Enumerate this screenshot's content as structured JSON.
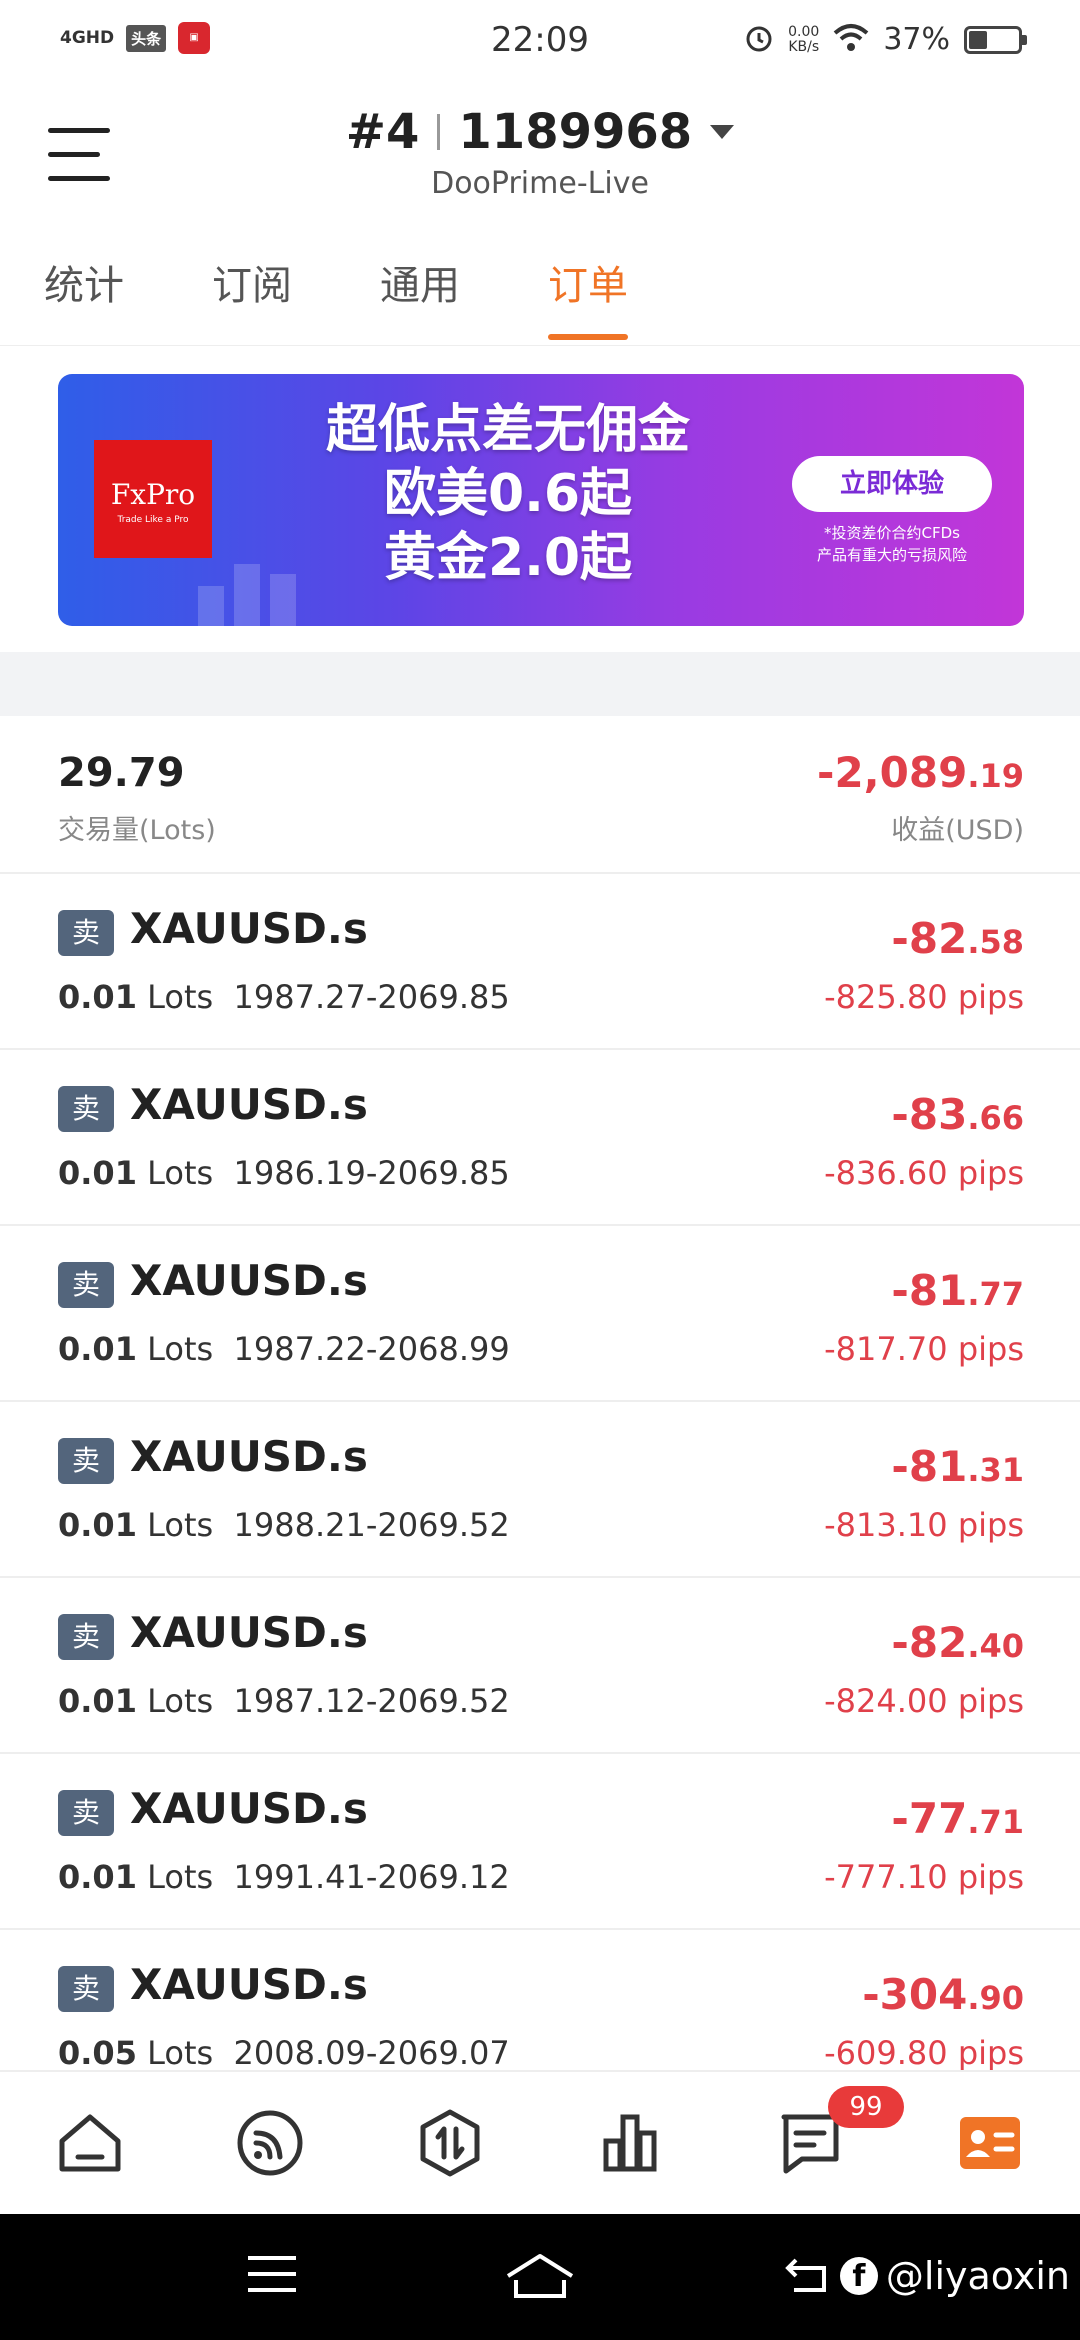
{
  "status_bar": {
    "network": "4GHD",
    "app_badge": "头条",
    "time": "22:09",
    "speed_value": "0.00",
    "speed_unit": "KB/s",
    "battery": "37%",
    "battery_level": 0.37
  },
  "header": {
    "account_id": "#4",
    "account_number": "1189968",
    "server": "DooPrime-Live"
  },
  "tabs": [
    {
      "label": "统计",
      "active": false
    },
    {
      "label": "订阅",
      "active": false
    },
    {
      "label": "通用",
      "active": false
    },
    {
      "label": "订单",
      "active": true
    }
  ],
  "banner": {
    "logo_name": "FxPro",
    "logo_tagline": "Trade Like a Pro",
    "line1": "超低点差无佣金",
    "line2": "欧美0.6起",
    "line3": "黄金2.0起",
    "cta": "立即体验",
    "note1": "*投资差价合约CFDs",
    "note2": "产品有重大的亏损风险"
  },
  "summary": {
    "volume": "29.79",
    "volume_label": "交易量(Lots)",
    "profit_int": "-2,089",
    "profit_dec": ".19",
    "profit_label": "收益(USD)"
  },
  "orders": [
    {
      "side": "卖",
      "symbol": "XAUUSD.s",
      "lots": "0.01",
      "lots_unit": "Lots",
      "prices": "1987.27-2069.85",
      "pl_int": "-82",
      "pl_dec": ".58",
      "pips": "-825.80 pips"
    },
    {
      "side": "卖",
      "symbol": "XAUUSD.s",
      "lots": "0.01",
      "lots_unit": "Lots",
      "prices": "1986.19-2069.85",
      "pl_int": "-83",
      "pl_dec": ".66",
      "pips": "-836.60 pips"
    },
    {
      "side": "卖",
      "symbol": "XAUUSD.s",
      "lots": "0.01",
      "lots_unit": "Lots",
      "prices": "1987.22-2068.99",
      "pl_int": "-81",
      "pl_dec": ".77",
      "pips": "-817.70 pips"
    },
    {
      "side": "卖",
      "symbol": "XAUUSD.s",
      "lots": "0.01",
      "lots_unit": "Lots",
      "prices": "1988.21-2069.52",
      "pl_int": "-81",
      "pl_dec": ".31",
      "pips": "-813.10 pips"
    },
    {
      "side": "卖",
      "symbol": "XAUUSD.s",
      "lots": "0.01",
      "lots_unit": "Lots",
      "prices": "1987.12-2069.52",
      "pl_int": "-82",
      "pl_dec": ".40",
      "pips": "-824.00 pips"
    },
    {
      "side": "卖",
      "symbol": "XAUUSD.s",
      "lots": "0.01",
      "lots_unit": "Lots",
      "prices": "1991.41-2069.12",
      "pl_int": "-77",
      "pl_dec": ".71",
      "pips": "-777.10 pips"
    },
    {
      "side": "卖",
      "symbol": "XAUUSD.s",
      "lots": "0.05",
      "lots_unit": "Lots",
      "prices": "2008.09-2069.07",
      "pl_int": "-304",
      "pl_dec": ".90",
      "pips": "-609.80 pips"
    }
  ],
  "bottom_nav": {
    "items": [
      "home-icon",
      "feed-icon",
      "trade-icon",
      "chart-icon",
      "message-icon",
      "profile-icon"
    ],
    "message_badge": "99",
    "accent_color": "#f07426"
  },
  "watermark": {
    "handle": "@liyaoxin"
  },
  "colors": {
    "accent": "#f07426",
    "loss": "#e0404a",
    "side_badge": "#53657c"
  }
}
